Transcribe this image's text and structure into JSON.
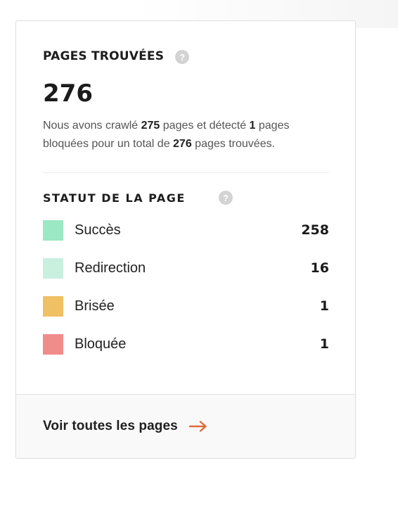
{
  "card": {
    "title": "PAGES TROUVÉES",
    "help_glyph": "?",
    "total": "276",
    "description": {
      "p1": "Nous avons crawlé ",
      "crawled": "275",
      "p2": " pages et détecté ",
      "blocked": "1",
      "p3": " pages bloquées pour un total de ",
      "total": "276",
      "p4": " pages trouvées."
    },
    "status_title": "STATUT DE LA PAGE",
    "status_items": [
      {
        "label": "Succès",
        "value": "258",
        "color": "#9be8c4"
      },
      {
        "label": "Redirection",
        "value": "16",
        "color": "#c9efdf"
      },
      {
        "label": "Brisée",
        "value": "1",
        "color": "#f0c064"
      },
      {
        "label": "Bloquée",
        "value": "1",
        "color": "#f08c8a"
      }
    ],
    "footer_link": "Voir toutes les pages",
    "arrow_icon": "arrow-right-icon",
    "accent_color": "#e06a3a"
  }
}
